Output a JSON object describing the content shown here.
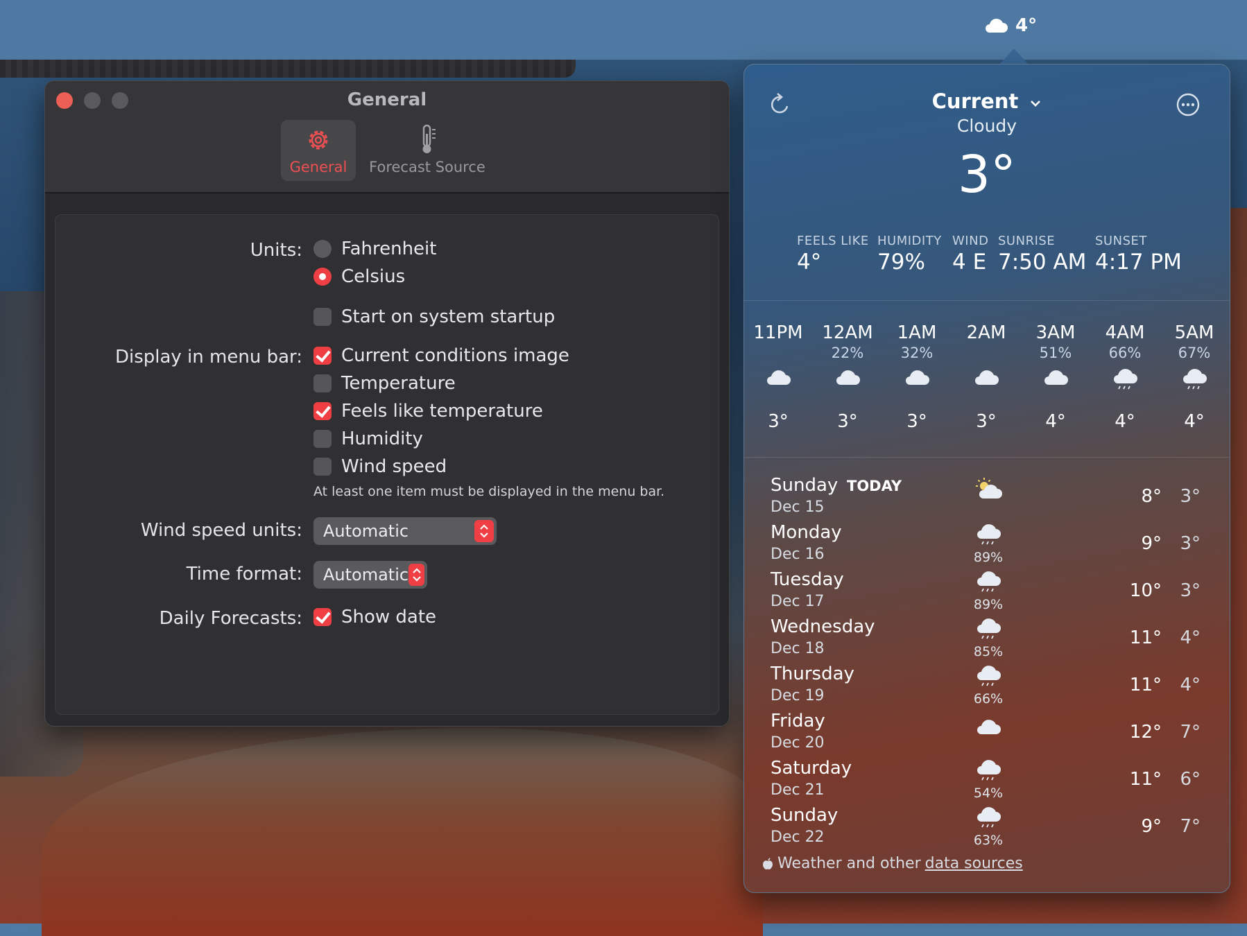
{
  "menubar": {
    "weather_temp": "4°"
  },
  "settings": {
    "window_title": "General",
    "tabs": [
      {
        "label": "General"
      },
      {
        "label": "Forecast Source"
      }
    ],
    "units_label": "Units:",
    "units_fahrenheit": "Fahrenheit",
    "units_celsius": "Celsius",
    "startup_label": "Start on system startup",
    "display_label": "Display in menu bar:",
    "display_items": [
      {
        "label": "Current conditions image",
        "checked": true
      },
      {
        "label": "Temperature",
        "checked": false
      },
      {
        "label": "Feels like temperature",
        "checked": true
      },
      {
        "label": "Humidity",
        "checked": false
      },
      {
        "label": "Wind speed",
        "checked": false
      }
    ],
    "display_note": "At least one item must be displayed in the menu bar.",
    "wind_units_label": "Wind speed units:",
    "wind_units_value": "Automatic",
    "time_format_label": "Time format:",
    "time_format_value": "Automatic",
    "daily_label": "Daily Forecasts:",
    "show_date_label": "Show date"
  },
  "weather": {
    "location": "Current",
    "condition": "Cloudy",
    "temperature": "3°",
    "stats": [
      {
        "key": "FEELS LIKE",
        "value": "4°"
      },
      {
        "key": "HUMIDITY",
        "value": "79%"
      },
      {
        "key": "WIND",
        "value": "4 E"
      },
      {
        "key": "SUNRISE",
        "value": "7:50 AM"
      },
      {
        "key": "SUNSET",
        "value": "4:17 PM"
      }
    ],
    "hourly": [
      {
        "time": "11PM",
        "precip": "",
        "temp": "3°",
        "icon": "cloud-icon"
      },
      {
        "time": "12AM",
        "precip": "22%",
        "temp": "3°",
        "icon": "cloud-icon"
      },
      {
        "time": "1AM",
        "precip": "32%",
        "temp": "3°",
        "icon": "cloud-icon"
      },
      {
        "time": "2AM",
        "precip": "",
        "temp": "3°",
        "icon": "cloud-icon"
      },
      {
        "time": "3AM",
        "precip": "51%",
        "temp": "4°",
        "icon": "cloud-icon"
      },
      {
        "time": "4AM",
        "precip": "66%",
        "temp": "4°",
        "icon": "cloud-drizzle-icon"
      },
      {
        "time": "5AM",
        "precip": "67%",
        "temp": "4°",
        "icon": "cloud-drizzle-icon"
      }
    ],
    "today_badge": "TODAY",
    "daily": [
      {
        "day": "Sunday",
        "date": "Dec 15",
        "precip": "",
        "hi": "8°",
        "lo": "3°",
        "icon": "partly-cloudy-icon"
      },
      {
        "day": "Monday",
        "date": "Dec 16",
        "precip": "89%",
        "hi": "9°",
        "lo": "3°",
        "icon": "cloud-drizzle-icon"
      },
      {
        "day": "Tuesday",
        "date": "Dec 17",
        "precip": "89%",
        "hi": "10°",
        "lo": "3°",
        "icon": "cloud-drizzle-icon"
      },
      {
        "day": "Wednesday",
        "date": "Dec 18",
        "precip": "85%",
        "hi": "11°",
        "lo": "4°",
        "icon": "cloud-drizzle-icon"
      },
      {
        "day": "Thursday",
        "date": "Dec 19",
        "precip": "66%",
        "hi": "11°",
        "lo": "4°",
        "icon": "cloud-drizzle-icon"
      },
      {
        "day": "Friday",
        "date": "Dec 20",
        "precip": "",
        "hi": "12°",
        "lo": "7°",
        "icon": "cloud-icon"
      },
      {
        "day": "Saturday",
        "date": "Dec 21",
        "precip": "54%",
        "hi": "11°",
        "lo": "6°",
        "icon": "cloud-drizzle-icon"
      },
      {
        "day": "Sunday",
        "date": "Dec 22",
        "precip": "63%",
        "hi": "9°",
        "lo": "7°",
        "icon": "cloud-drizzle-icon"
      }
    ],
    "footer_text": "Weather and other",
    "footer_link": "data sources"
  },
  "colors": {
    "accent": "#ef3f44"
  }
}
